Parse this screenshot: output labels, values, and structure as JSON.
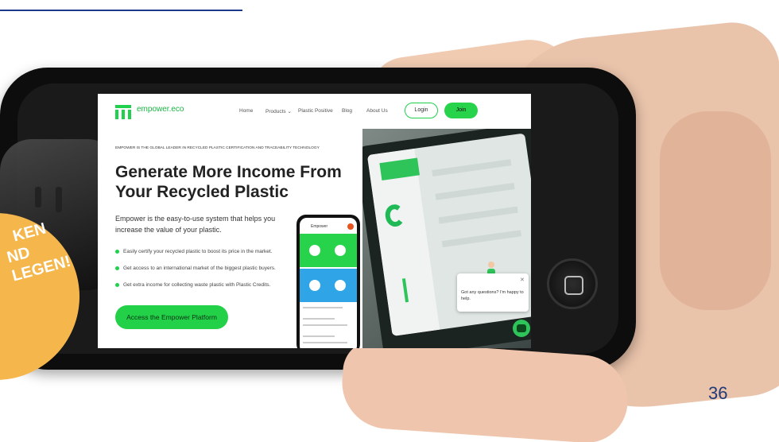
{
  "page": {
    "page_number": "36",
    "badge_lines": [
      "KEN",
      "ND",
      "LEGEN!"
    ]
  },
  "site": {
    "logo_text": "empower.eco",
    "nav": [
      "Home",
      "Products ⌄",
      "Plastic Positive",
      "Blog",
      "About Us"
    ],
    "login": "Login",
    "join": "Join",
    "eyebrow": "EMPOWER IS THE GLOBAL LEADER IN RECYCLED PLASTIC CERTIFICATION AND TRACEABILITY TECHNOLOGY",
    "headline": "Generate More Income From Your Recycled Plastic",
    "lead": "Empower is the easy-to-use system that helps you increase the value of your plastic.",
    "bullets": [
      "Easily certify your recycled plastic to boost its price in the market.",
      "Get access to an international market of the biggest plastic buyers.",
      "Get extra income for collecting waste plastic with Plastic Credits."
    ],
    "cta": "Access the Empower Platform",
    "mini_app_title": "Empower",
    "chat_text": "Got any questions? I'm happy to help.",
    "chat_close": "✕"
  },
  "colors": {
    "brand_green": "#27d34a",
    "badge_orange": "#f5b74c",
    "page_number_blue": "#1f3b7a"
  }
}
